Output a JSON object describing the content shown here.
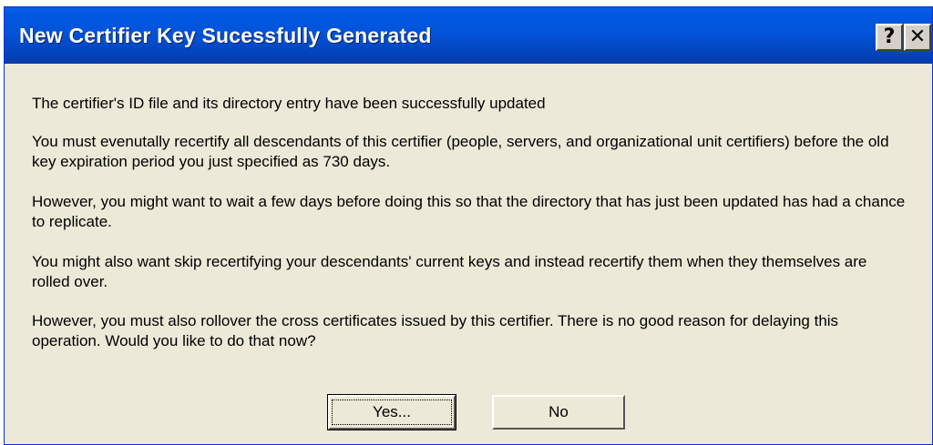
{
  "dialog": {
    "title": "New Certifier Key Sucessfully Generated",
    "help_label": "?",
    "close_label": "✕",
    "paragraphs": [
      "The certifier's ID file and its directory entry have been successfully updated",
      "You must evenutally recertify all descendants of this certifier (people, servers, and organizational unit certifiers) before the old key expiration period you just specified as 730 days.",
      "However, you might want to wait a few days before doing this so that the directory that has just been updated has had a chance to replicate.",
      "You might also want skip recertifying your descendants' current keys and instead recertify them when they themselves are rolled over.",
      "However, you must also rollover the cross certificates issued by this certifier.  There is no good reason for delaying this operation.  Would you like to do that now?"
    ],
    "buttons": {
      "yes_label": "Yes...",
      "no_label": "No"
    }
  },
  "colors": {
    "titlebar": "#0253d9",
    "title_text": "#ffffff",
    "dialog_background": "#ece9d8"
  }
}
